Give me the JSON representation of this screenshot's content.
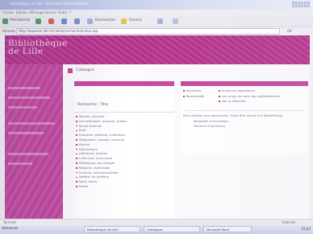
{
  "window": {
    "title": "Bibliothèque de Lille - Microsoft Internet Explorer"
  },
  "menu": [
    "Fichier",
    "Edition",
    "Affichage",
    "Favoris",
    "Outils",
    "?"
  ],
  "toolbar": {
    "back": "Précédente",
    "search": "Rechercher",
    "favorites": "Favoris"
  },
  "address": {
    "label": "Adresse",
    "url": "http://www.bm-lille.fr/clients/recherche/index.asp",
    "go": "OK"
  },
  "banner": {
    "title_line1": "Bibliothèque",
    "title_line2": "de Lille"
  },
  "breadcrumb": "Catalogue",
  "left_panel": {
    "search_label": "Recherche : Titre",
    "items": [
      "Agenda, annuaire",
      "Arts plastiques, musique, cinéma",
      "Bande dessinée",
      "Droit",
      "Economie, politique, institutions",
      "Géographie, voyages, tourisme",
      "Histoire",
      "Informatique",
      "Littérature, langues",
      "Livres pour la jeunesse",
      "Philosophie, psychologie",
      "Religions, mythologie",
      "Sciences, sciences sociales",
      "Société, vie pratique",
      "Sport, loisirs",
      "Presse"
    ]
  },
  "right_panel": {
    "links_col1": [
      "Actualités",
      "Nouveautés"
    ],
    "links_col2": [
      "Toutes les expositions",
      "Les coups de cœur des bibliothécaires",
      "Voir la sélection"
    ],
    "note": "Pour accéder aux documents, il faut être inscrit à la bibliothèque",
    "sub_links": [
      "Modalités d'inscription",
      "Horaires d'ouverture"
    ]
  },
  "status": {
    "left": "Terminé",
    "right": "Internet"
  },
  "taskbar": {
    "start": "démarrer",
    "buttons": [
      "Bibliothèque de Lille",
      "Catalogue",
      "Microsoft Word"
    ],
    "clock": "15:42"
  },
  "colors": {
    "brand": "#b9358f",
    "sidebar": "#c64ba1"
  }
}
